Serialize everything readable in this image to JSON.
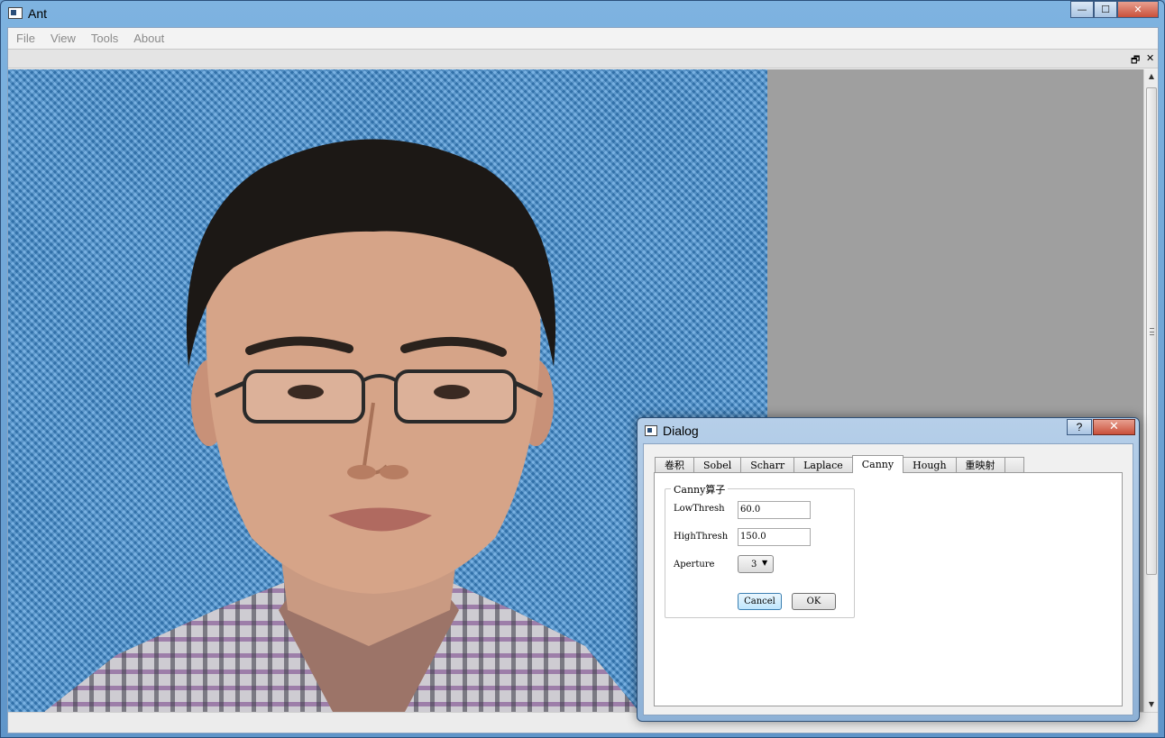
{
  "window": {
    "title": "Ant"
  },
  "window_buttons": {
    "minimize": "—",
    "maximize": "☐",
    "close": "✕"
  },
  "menu": [
    "File",
    "View",
    "Tools",
    "About"
  ],
  "dock": {
    "float_icon": "🗗",
    "close_icon": "✕"
  },
  "scrollbar": {
    "up": "▲",
    "down": "▼"
  },
  "dialog": {
    "title": "Dialog",
    "help": "?",
    "close": "✕",
    "tabs": [
      "卷积",
      "Sobel",
      "Scharr",
      "Laplace",
      "Canny",
      "Hough",
      "重映射",
      ""
    ],
    "active_tab": "Canny",
    "group_title": "Canny算子",
    "fields": {
      "low_label": "LowThresh",
      "low_value": "60.0",
      "high_label": "HighThresh",
      "high_value": "150.0",
      "aperture_label": "Aperture",
      "aperture_value": "3"
    },
    "buttons": {
      "cancel": "Cancel",
      "ok": "OK"
    }
  }
}
